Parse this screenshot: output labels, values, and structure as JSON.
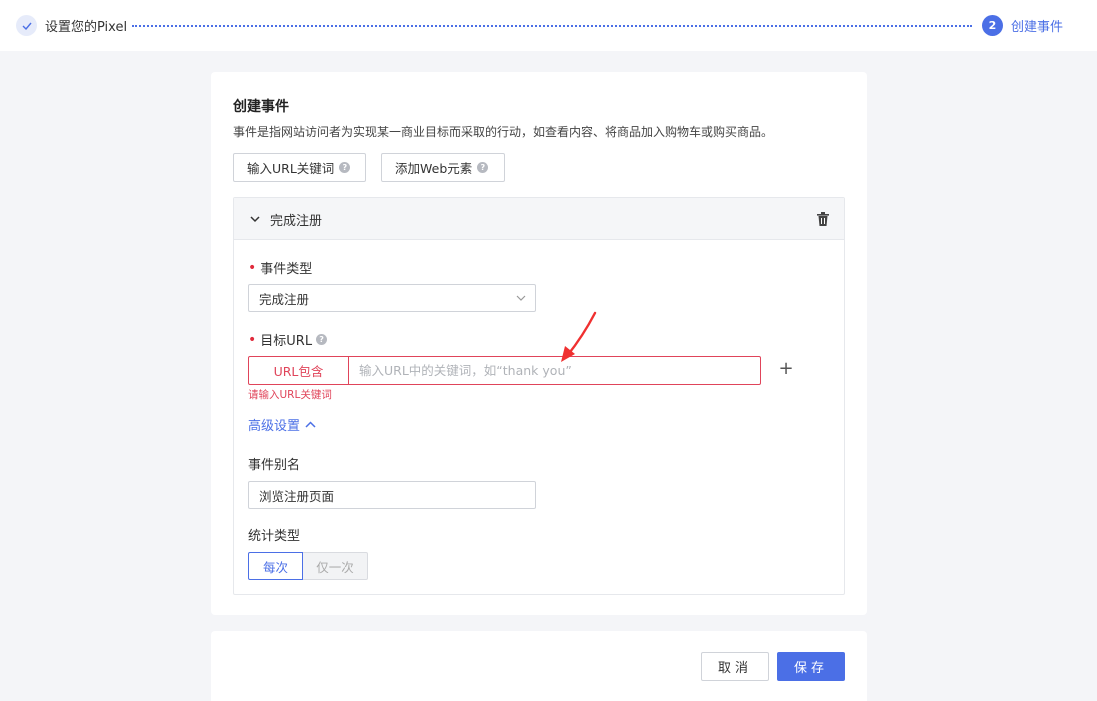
{
  "stepper": {
    "step1": {
      "label": "设置您的Pixel",
      "icon": "check-icon"
    },
    "step2": {
      "number": "2",
      "label": "创建事件"
    }
  },
  "card": {
    "title": "创建事件",
    "description": "事件是指网站访问者为实现某一商业目标而采取的行动，如查看内容、将商品加入购物车或购买商品。",
    "buttons": {
      "url_keyword": "输入URL关键词",
      "web_element": "添加Web元素"
    }
  },
  "event_panel": {
    "title": "完成注册",
    "event_type": {
      "label": "事件类型",
      "value": "完成注册"
    },
    "target_url": {
      "label": "目标URL",
      "prefix": "URL包含",
      "value": "",
      "placeholder": "输入URL中的关键词，如“thank you”",
      "error": "请输入URL关键词"
    },
    "advanced_label": "高级设置",
    "alias": {
      "label": "事件别名",
      "value": "浏览注册页面"
    },
    "count_type": {
      "label": "统计类型",
      "options": [
        "每次",
        "仅一次"
      ],
      "selected": "每次"
    }
  },
  "footer": {
    "cancel_label": "取消",
    "save_label": "保存"
  },
  "colors": {
    "primary": "#4b6fe6",
    "error": "#e0445a",
    "annotation": "#f03030"
  }
}
